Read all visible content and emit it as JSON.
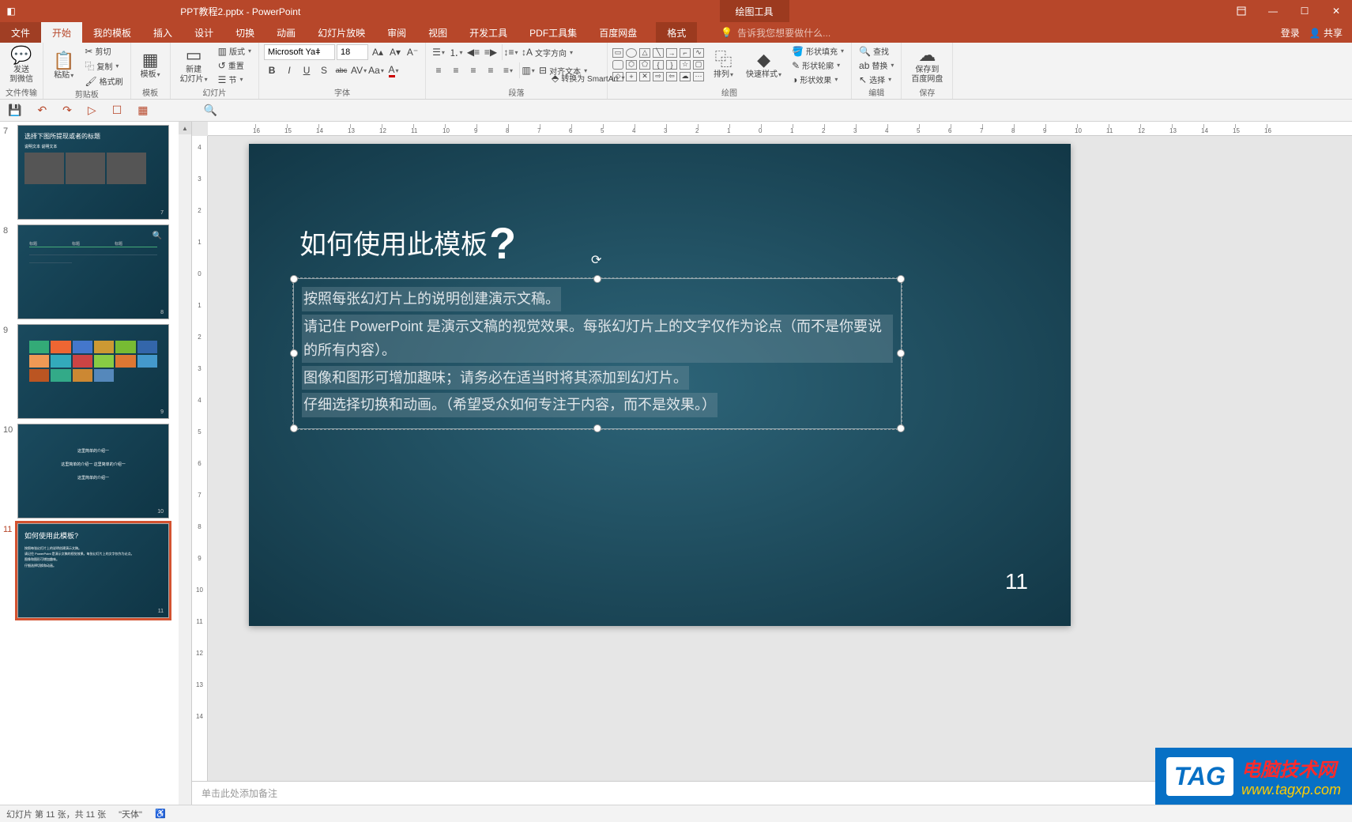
{
  "titlebar": {
    "document": "PPT教程2.pptx - PowerPoint",
    "context_tool": "绘图工具"
  },
  "window_controls": {
    "ribbon_opts": "▢",
    "min": "—",
    "max": "☐",
    "close": "✕"
  },
  "menu": {
    "file": "文件",
    "home": "开始",
    "my_template": "我的模板",
    "insert": "插入",
    "design": "设计",
    "transitions": "切换",
    "animations": "动画",
    "slideshow": "幻灯片放映",
    "review": "审阅",
    "view": "视图",
    "developer": "开发工具",
    "pdf": "PDF工具集",
    "baidu": "百度网盘",
    "format": "格式",
    "tell_me": "告诉我您想要做什么...",
    "login": "登录",
    "share": "共享"
  },
  "ribbon": {
    "wechat": {
      "label": "发送\n到微信",
      "group": "文件传输"
    },
    "clipboard": {
      "paste": "粘贴",
      "cut": "剪切",
      "copy": "复制",
      "format_painter": "格式刷",
      "group": "剪贴板"
    },
    "template": {
      "label": "模板",
      "group": "模板"
    },
    "slides": {
      "new_slide": "新建\n幻灯片",
      "layout": "版式",
      "reset": "重置",
      "section": "节",
      "group": "幻灯片"
    },
    "font": {
      "name": "Microsoft Yaǂ",
      "size": "18",
      "bold": "B",
      "italic": "I",
      "underline": "U",
      "shadow": "S",
      "strike": "abc",
      "spacing": "AV",
      "case": "Aa",
      "clear": "A",
      "color": "A",
      "group": "字体"
    },
    "paragraph": {
      "bullets": "≡",
      "numbering": "≡",
      "indent_dec": "≤",
      "indent_inc": "≥",
      "text_dir": "文字方向",
      "align_text": "对齐文本",
      "smartart": "转换为 SmartArt",
      "group": "段落"
    },
    "drawing": {
      "arrange": "排列",
      "quick_styles": "快速样式",
      "fill": "形状填充",
      "outline": "形状轮廓",
      "effects": "形状效果",
      "group": "绘图"
    },
    "editing": {
      "find": "查找",
      "replace": "替换",
      "select": "选择",
      "group": "编辑"
    },
    "save": {
      "label": "保存到\n百度网盘",
      "group": "保存"
    }
  },
  "qat": {
    "save": "💾",
    "undo": "↶",
    "redo": "↷",
    "start": "▷",
    "touch": "☐",
    "table": "▦",
    "zoom_sel": "🔍"
  },
  "ruler_h": [
    "16",
    "15",
    "14",
    "13",
    "12",
    "11",
    "10",
    "9",
    "8",
    "7",
    "6",
    "5",
    "4",
    "3",
    "2",
    "1",
    "0",
    "1",
    "2",
    "3",
    "4",
    "5",
    "6",
    "7",
    "8",
    "9",
    "10",
    "11",
    "12",
    "13",
    "14",
    "15",
    "16"
  ],
  "ruler_v": [
    "4",
    "3",
    "2",
    "1",
    "0",
    "1",
    "2",
    "3",
    "4",
    "5",
    "6",
    "7",
    "8",
    "9",
    "10",
    "11",
    "12",
    "13",
    "14"
  ],
  "thumbnails": [
    {
      "num": "7",
      "title": "选择下图所提现或者的标题",
      "subtext": true,
      "kind": "photos"
    },
    {
      "num": "8",
      "title": "",
      "kind": "table"
    },
    {
      "num": "9",
      "title": "",
      "kind": "imagegrid"
    },
    {
      "num": "10",
      "title": "",
      "kind": "textlines",
      "lines": [
        "这里简单的介绍一",
        "这里简单的介绍一  这里简单的介绍一",
        "这里简单的介绍一"
      ]
    },
    {
      "num": "11",
      "title": "如何使用此模板?",
      "kind": "current",
      "active": true
    }
  ],
  "slide": {
    "title": "如何使用此模板",
    "title_mark": "?",
    "lines": [
      "按照每张幻灯片上的说明创建演示文稿。",
      "请记住 PowerPoint 是演示文稿的视觉效果。每张幻灯片上的文字仅作为论点（而不是你要说的所有内容）。",
      "图像和图形可增加趣味；请务必在适当时将其添加到幻灯片。",
      "仔细选择切换和动画。（希望受众如何专注于内容，而不是效果。）"
    ],
    "number": "11"
  },
  "notes": {
    "placeholder": "单击此处添加备注"
  },
  "statusbar": {
    "slide_info": "幻灯片 第 11 张，共 11 张",
    "lang": "\"天体\"",
    "a11y": "♿"
  },
  "watermark": {
    "tag": "TAG",
    "cn": "电脑技术网",
    "url": "www.tagxp.com"
  }
}
